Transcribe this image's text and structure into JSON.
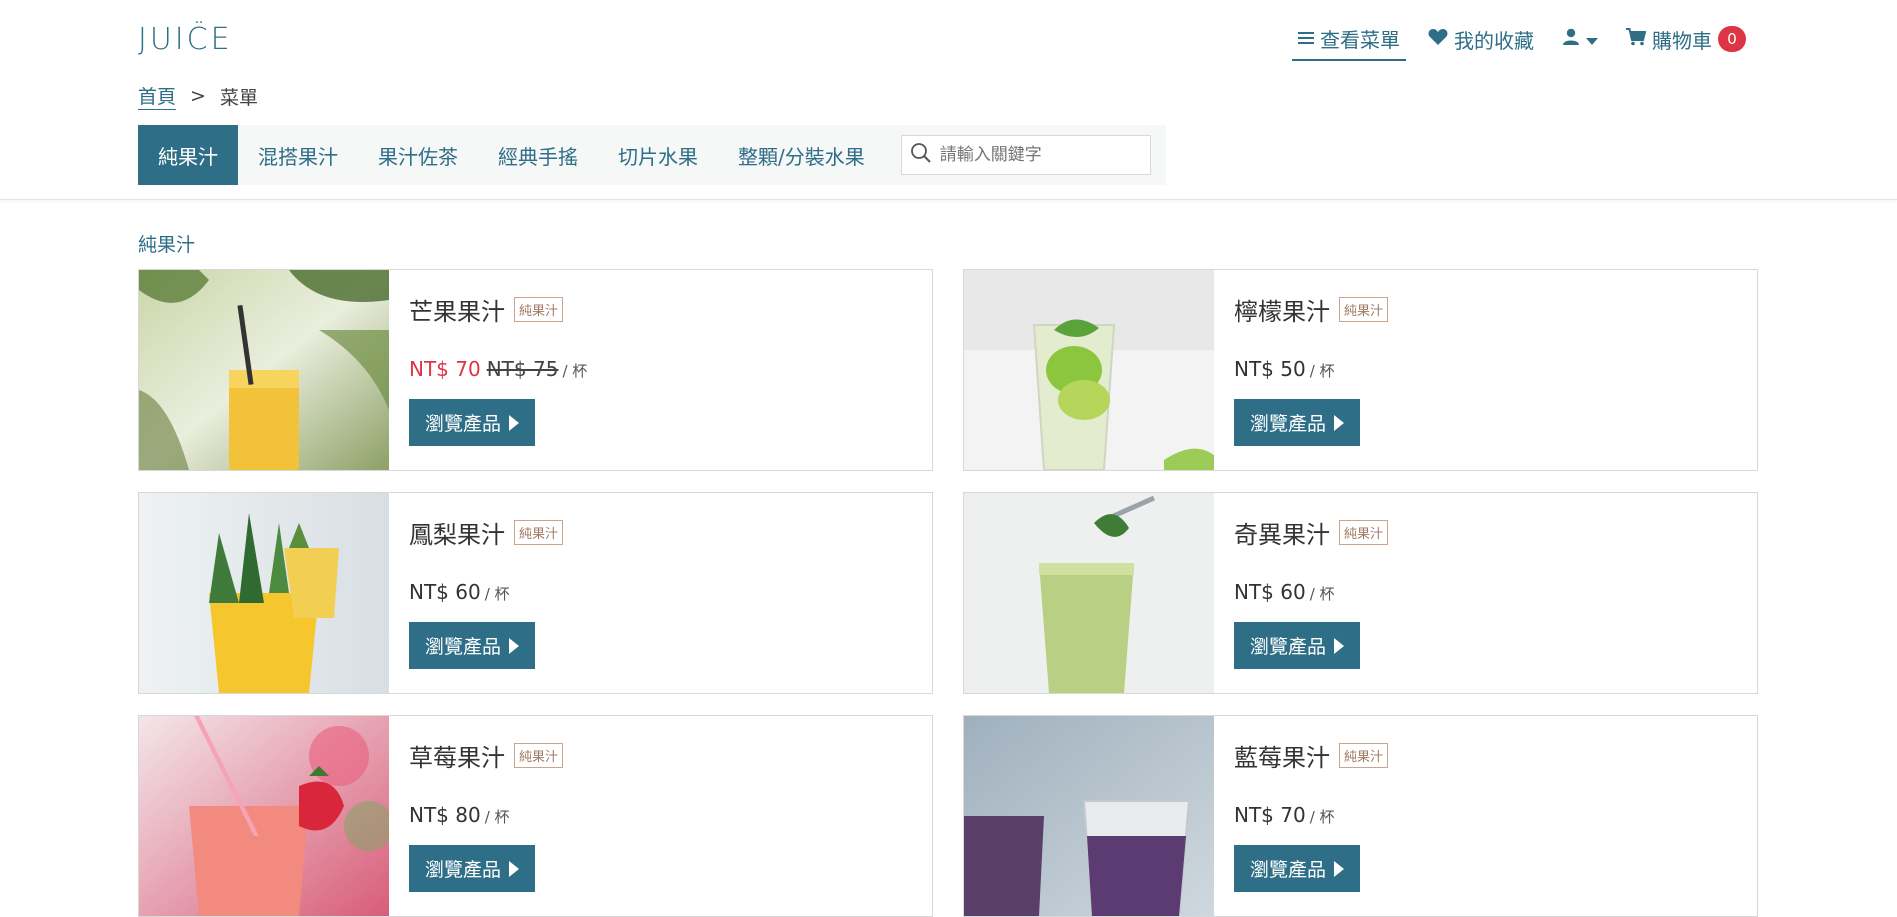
{
  "brand": {
    "logo": "JUIC̈E"
  },
  "nav": {
    "menu_label": "查看菜單",
    "favorites_label": "我的收藏",
    "cart_label": "購物車",
    "cart_count": "0"
  },
  "breadcrumb": {
    "home": "首頁",
    "separator": ">",
    "current": "菜單"
  },
  "tabs": [
    "純果汁",
    "混搭果汁",
    "果汁佐茶",
    "經典手搖",
    "切片水果",
    "整顆/分裝水果"
  ],
  "search": {
    "placeholder": "請輸入關鍵字"
  },
  "section_title": "純果汁",
  "products": [
    {
      "name": "芒果果汁",
      "tag": "純果汁",
      "price": "NT$ 70",
      "original_price": "NT$ 75",
      "unit": "/ 杯",
      "button": "瀏覽產品"
    },
    {
      "name": "檸檬果汁",
      "tag": "純果汁",
      "price": "NT$ 50",
      "original_price": "",
      "unit": "/ 杯",
      "button": "瀏覽產品"
    },
    {
      "name": "鳳梨果汁",
      "tag": "純果汁",
      "price": "NT$ 60",
      "original_price": "",
      "unit": "/ 杯",
      "button": "瀏覽產品"
    },
    {
      "name": "奇異果汁",
      "tag": "純果汁",
      "price": "NT$ 60",
      "original_price": "",
      "unit": "/ 杯",
      "button": "瀏覽產品"
    },
    {
      "name": "草莓果汁",
      "tag": "純果汁",
      "price": "NT$ 80",
      "original_price": "",
      "unit": "/ 杯",
      "button": "瀏覽產品"
    },
    {
      "name": "藍莓果汁",
      "tag": "純果汁",
      "price": "NT$ 70",
      "original_price": "",
      "unit": "/ 杯",
      "button": "瀏覽產品"
    }
  ],
  "colors": {
    "primary": "#2e6e87",
    "sale": "#dc3545",
    "tag": "#a07a62"
  }
}
